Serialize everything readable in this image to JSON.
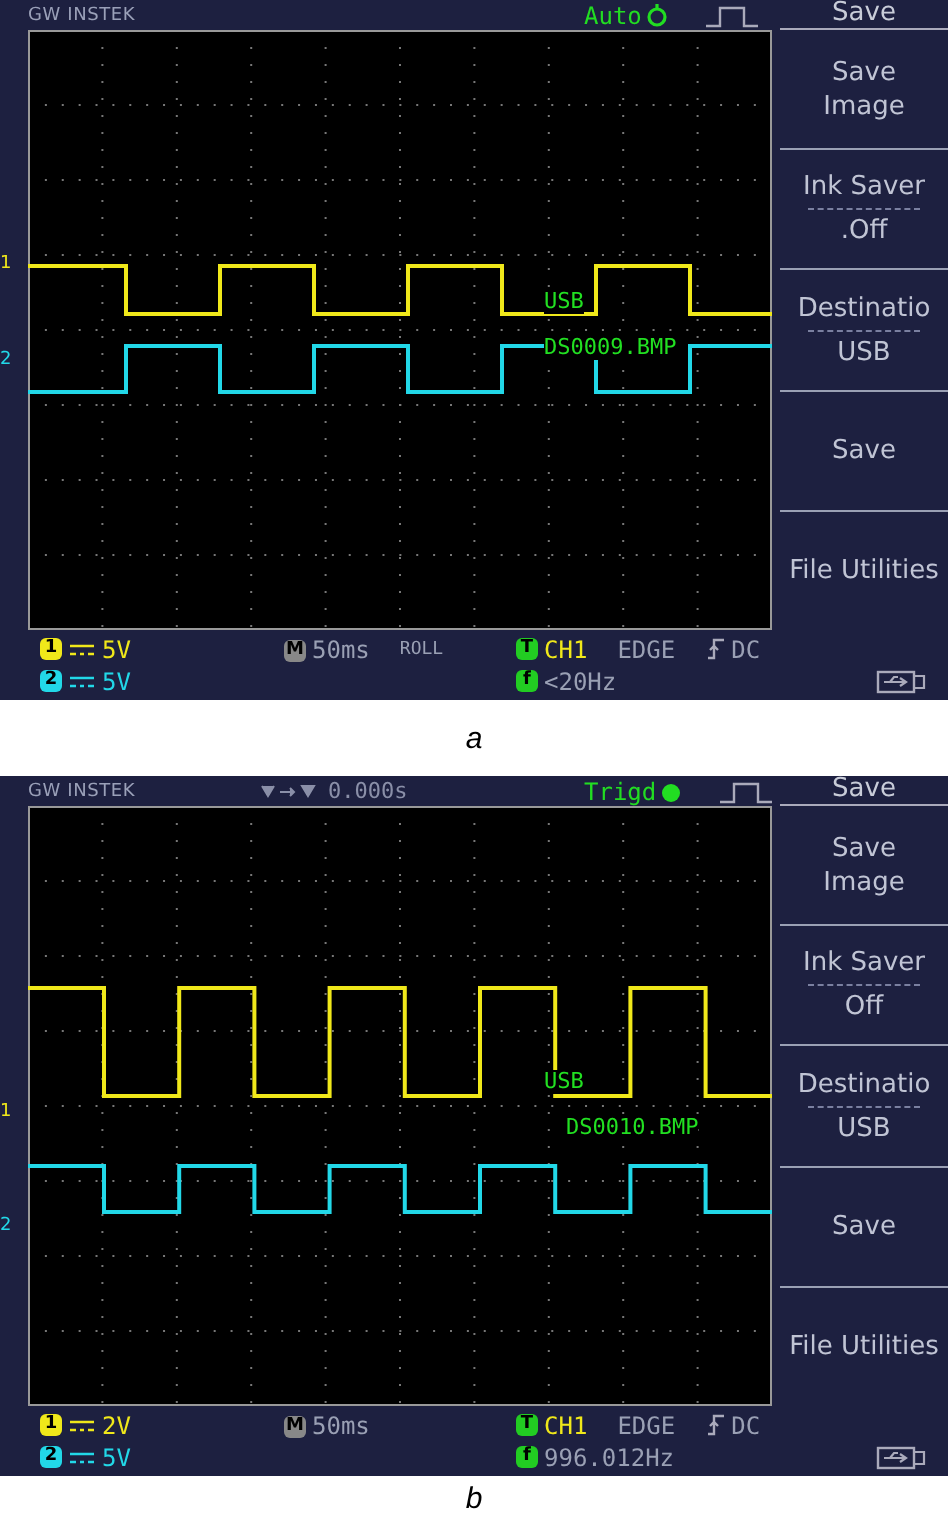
{
  "figures": [
    {
      "header": {
        "brand": "GW INSTEK",
        "trigger_status": {
          "kind": "auto",
          "label": "Auto"
        },
        "menu_title": "Save"
      },
      "channel_markers": [
        "1",
        "2"
      ],
      "overlay": [
        "USB",
        "DS0009.BMP"
      ],
      "menu": [
        {
          "label": "Save Image"
        },
        {
          "label": "Ink Saver",
          "value": ".Off"
        },
        {
          "label": "Destinatio",
          "value": "USB"
        },
        {
          "label": "Save"
        },
        {
          "label": "File Utilities"
        }
      ],
      "footer": {
        "ch1_badge": "1",
        "ch1_scale": "5V",
        "ch2_badge": "2",
        "ch2_scale": "5V",
        "time_badge": "M",
        "timebase": "50ms",
        "mode": "ROLL",
        "trigger_badge": "T",
        "trigger_source": "CH1",
        "trigger_type": "EDGE",
        "coupling": "DC",
        "freq_badge": "f",
        "frequency": "<20Hz"
      },
      "caption": "a"
    },
    {
      "header": {
        "brand": "GW INSTEK",
        "position": "0.000s",
        "trigger_status": {
          "kind": "triggered",
          "label": "Trigd"
        },
        "menu_title": "Save"
      },
      "channel_markers": [
        "1",
        "2"
      ],
      "overlay": [
        "USB",
        "DS0010.BMP"
      ],
      "menu": [
        {
          "label": "Save Image"
        },
        {
          "label": "Ink Saver",
          "value": "Off"
        },
        {
          "label": "Destinatio",
          "value": "USB"
        },
        {
          "label": "Save"
        },
        {
          "label": "File Utilities"
        }
      ],
      "footer": {
        "ch1_badge": "1",
        "ch1_scale": "2V",
        "ch2_badge": "2",
        "ch2_scale": "5V",
        "time_badge": "M",
        "timebase": "50ms",
        "trigger_badge": "T",
        "trigger_source": "CH1",
        "trigger_type": "EDGE",
        "coupling": "DC",
        "freq_badge": "f",
        "frequency": "996.012Hz"
      },
      "caption": "b"
    }
  ]
}
